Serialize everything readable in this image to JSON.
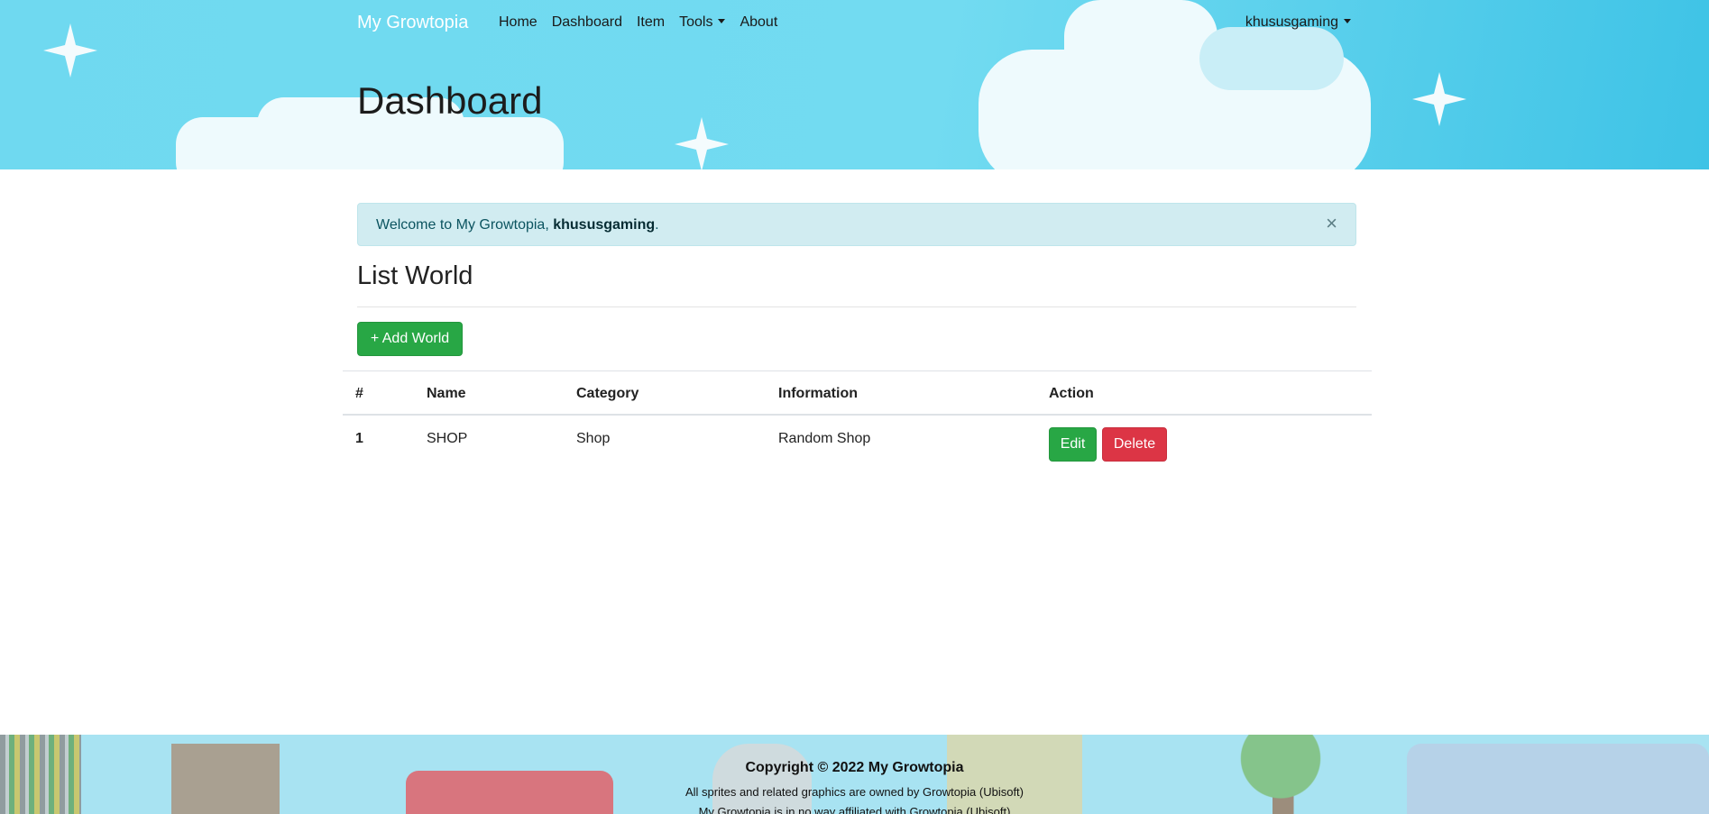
{
  "nav": {
    "brand": "My Growtopia",
    "links": [
      "Home",
      "Dashboard",
      "Item",
      "Tools",
      "About"
    ],
    "user": "khususgaming"
  },
  "header": {
    "title": "Dashboard"
  },
  "alert": {
    "prefix": "Welcome to My Growtopia, ",
    "username": "khususgaming",
    "suffix": ".",
    "close": "×"
  },
  "worlds": {
    "title": "List World",
    "add_label": "+ Add World",
    "columns": [
      "#",
      "Name",
      "Category",
      "Information",
      "Action"
    ],
    "rows": [
      {
        "id": "1",
        "name": "SHOP",
        "category": "Shop",
        "information": "Random Shop",
        "edit": "Edit",
        "delete": "Delete"
      }
    ]
  },
  "footer": {
    "copyright": "Copyright © 2022 My Growtopia",
    "line2": "All sprites and related graphics are owned by Growtopia (Ubisoft)",
    "line3": "My Growtopia is in no way affiliated with Growtopia (Ubisoft)"
  },
  "colors": {
    "success": "#28a745",
    "danger": "#dc3545",
    "alert_bg": "#d1ecf1",
    "sky": "#72dbf1"
  }
}
